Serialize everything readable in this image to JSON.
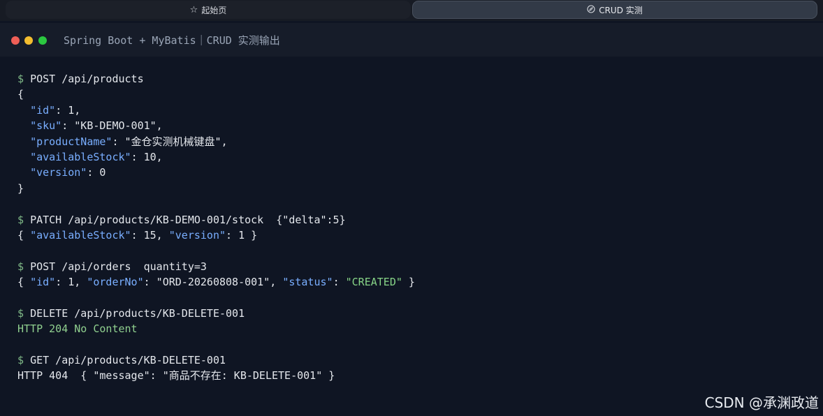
{
  "tabs": [
    {
      "label": "起始页",
      "icon": "star-icon",
      "active": false
    },
    {
      "label": "CRUD 实测",
      "icon": "compass-icon",
      "active": true
    }
  ],
  "window": {
    "title": "Spring Boot + MyBatis｜CRUD 实测输出",
    "controls": [
      "close",
      "minimize",
      "zoom"
    ]
  },
  "terminal": {
    "prompt": "$",
    "lines": {
      "l1_cmd": "POST /api/products",
      "l2": "{",
      "l3_key": "\"id\"",
      "l3_val": ": 1,",
      "l4_key": "\"sku\"",
      "l4_val": ": \"KB-DEMO-001\",",
      "l5_key": "\"productName\"",
      "l5_val": ": \"金仓实测机械键盘\",",
      "l6_key": "\"availableStock\"",
      "l6_val": ": 10,",
      "l7_key": "\"version\"",
      "l7_val": ": 0",
      "l8": "}",
      "l10_cmd": "PATCH /api/products/KB-DEMO-001/stock  {\"delta\":5}",
      "l11_open": "{ ",
      "l11_key1": "\"availableStock\"",
      "l11_mid": ": 15, ",
      "l11_key2": "\"version\"",
      "l11_end": ": 1 }",
      "l13_cmd": "POST /api/orders  quantity=3",
      "l14_open": "{ ",
      "l14_key1": "\"id\"",
      "l14_mid1": ": 1, ",
      "l14_key2": "\"orderNo\"",
      "l14_mid2": ": \"ORD-20260808-001\", ",
      "l14_key3": "\"status\"",
      "l14_mid3": ": ",
      "l14_status": "\"CREATED\"",
      "l14_end": " }",
      "l16_cmd": "DELETE /api/products/KB-DELETE-001",
      "l17": "HTTP 204 No Content",
      "l19_cmd": "GET /api/products/KB-DELETE-001",
      "l20": "HTTP 404  { \"message\": \"商品不存在: KB-DELETE-001\" }"
    }
  },
  "watermark": "CSDN @承渊政道",
  "colors": {
    "background": "#0f1523",
    "prompt": "#7fb987",
    "json_key": "#79aeff",
    "string_green": "#87d487",
    "text": "#e4e7ec"
  }
}
